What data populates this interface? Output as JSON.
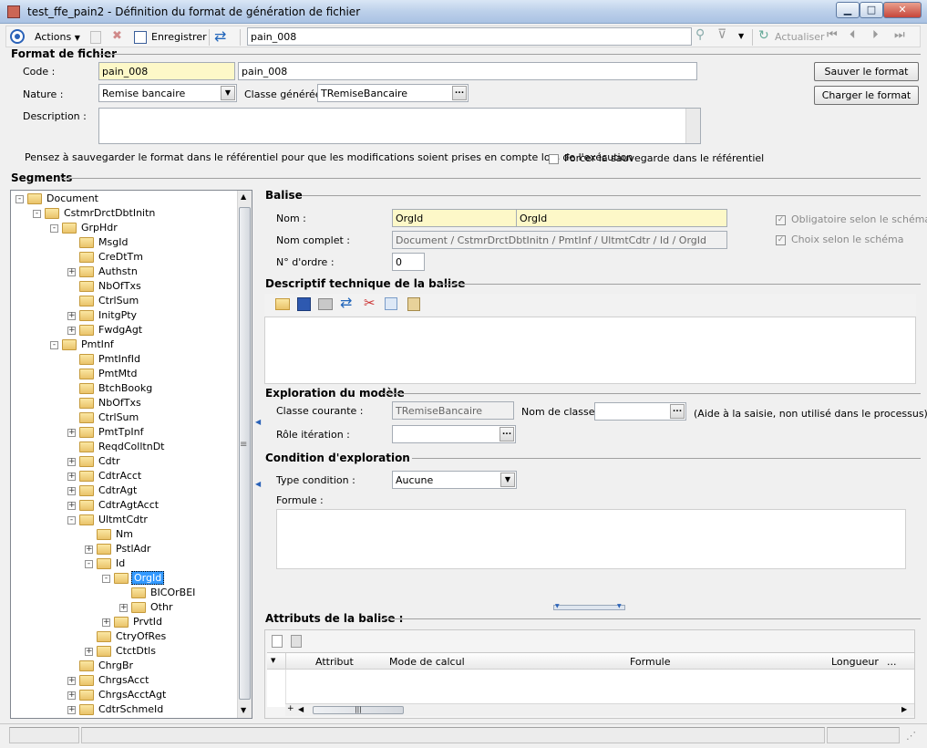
{
  "window": {
    "title": "test_ffe_pain2 -  Définition du format de génération de fichier",
    "min": "▁",
    "max": "□",
    "close": "✕"
  },
  "toolbar": {
    "actions_label": "Actions",
    "save_label": "Enregistrer",
    "search_value": "pain_008",
    "refresh_label": "Actualiser"
  },
  "format": {
    "section_title": "Format de fichier",
    "code_label": "Code :",
    "code_value": "pain_008",
    "name_value": "pain_008",
    "nature_label": "Nature :",
    "nature_value": "Remise bancaire",
    "classe_label": "Classe générée :",
    "classe_value": "TRemiseBancaire",
    "description_label": "Description :",
    "description_value": "",
    "save_format_label": "Sauver le format",
    "load_format_label": "Charger le format",
    "hint": "Pensez à sauvegarder le format dans le référentiel pour que les modifications soient prises en compte lors de l'exécution",
    "force_label": "Forcer la sauvegarde dans le référentiel"
  },
  "segments": {
    "title": "Segments",
    "tree": [
      {
        "label": "Document",
        "depth": 0,
        "exp": "-"
      },
      {
        "label": "CstmrDrctDbtInitn",
        "depth": 1,
        "exp": "-"
      },
      {
        "label": "GrpHdr",
        "depth": 2,
        "exp": "-"
      },
      {
        "label": "MsgId",
        "depth": 3,
        "exp": ""
      },
      {
        "label": "CreDtTm",
        "depth": 3,
        "exp": ""
      },
      {
        "label": "Authstn",
        "depth": 3,
        "exp": "+"
      },
      {
        "label": "NbOfTxs",
        "depth": 3,
        "exp": ""
      },
      {
        "label": "CtrlSum",
        "depth": 3,
        "exp": ""
      },
      {
        "label": "InitgPty",
        "depth": 3,
        "exp": "+"
      },
      {
        "label": "FwdgAgt",
        "depth": 3,
        "exp": "+"
      },
      {
        "label": "PmtInf",
        "depth": 2,
        "exp": "-"
      },
      {
        "label": "PmtInfId",
        "depth": 3,
        "exp": ""
      },
      {
        "label": "PmtMtd",
        "depth": 3,
        "exp": ""
      },
      {
        "label": "BtchBookg",
        "depth": 3,
        "exp": ""
      },
      {
        "label": "NbOfTxs",
        "depth": 3,
        "exp": ""
      },
      {
        "label": "CtrlSum",
        "depth": 3,
        "exp": ""
      },
      {
        "label": "PmtTpInf",
        "depth": 3,
        "exp": "+"
      },
      {
        "label": "ReqdColltnDt",
        "depth": 3,
        "exp": ""
      },
      {
        "label": "Cdtr",
        "depth": 3,
        "exp": "+"
      },
      {
        "label": "CdtrAcct",
        "depth": 3,
        "exp": "+"
      },
      {
        "label": "CdtrAgt",
        "depth": 3,
        "exp": "+"
      },
      {
        "label": "CdtrAgtAcct",
        "depth": 3,
        "exp": "+"
      },
      {
        "label": "UltmtCdtr",
        "depth": 3,
        "exp": "-"
      },
      {
        "label": "Nm",
        "depth": 4,
        "exp": ""
      },
      {
        "label": "PstlAdr",
        "depth": 4,
        "exp": "+"
      },
      {
        "label": "Id",
        "depth": 4,
        "exp": "-"
      },
      {
        "label": "OrgId",
        "depth": 5,
        "exp": "-",
        "selected": true
      },
      {
        "label": "BICOrBEI",
        "depth": 6,
        "exp": ""
      },
      {
        "label": "Othr",
        "depth": 6,
        "exp": "+"
      },
      {
        "label": "PrvtId",
        "depth": 5,
        "exp": "+"
      },
      {
        "label": "CtryOfRes",
        "depth": 4,
        "exp": ""
      },
      {
        "label": "CtctDtls",
        "depth": 4,
        "exp": "+"
      },
      {
        "label": "ChrgBr",
        "depth": 3,
        "exp": ""
      },
      {
        "label": "ChrgsAcct",
        "depth": 3,
        "exp": "+"
      },
      {
        "label": "ChrgsAcctAgt",
        "depth": 3,
        "exp": "+"
      },
      {
        "label": "CdtrSchmeId",
        "depth": 3,
        "exp": "+"
      }
    ]
  },
  "balise": {
    "title": "Balise",
    "nom_label": "Nom  :",
    "nom_value1": "OrgId",
    "nom_value2": "OrgId",
    "nom_complet_label": "Nom complet :",
    "nom_complet_value": "Document / CstmrDrctDbtInitn / PmtInf / UltmtCdtr / Id / OrgId",
    "ordre_label": "N° d'ordre :",
    "ordre_value": "0",
    "obligatoire_label": "Obligatoire selon le schéma",
    "choix_label": "Choix selon le schéma"
  },
  "descriptif": {
    "title": "Descriptif technique de la balise"
  },
  "exploration": {
    "title": "Exploration du modèle",
    "classe_courante_label": "Classe courante :",
    "classe_courante_value": "TRemiseBancaire",
    "nom_classe_label": "Nom de classe :",
    "nom_classe_value": "",
    "aide_label": "(Aide à la saisie, non utilisé dans le processus)",
    "role_label": "Rôle itération :",
    "role_value": ""
  },
  "condition": {
    "title": "Condition d'exploration",
    "type_label": "Type condition :",
    "type_value": "Aucune",
    "formule_label": "Formule :"
  },
  "attributs": {
    "title": "Attributs de la balise :",
    "columns": [
      "Attribut",
      "Mode de calcul",
      "Formule",
      "Longueur",
      "..."
    ],
    "scroll_mark": "|||"
  },
  "status": {
    "grip": "⋰"
  }
}
